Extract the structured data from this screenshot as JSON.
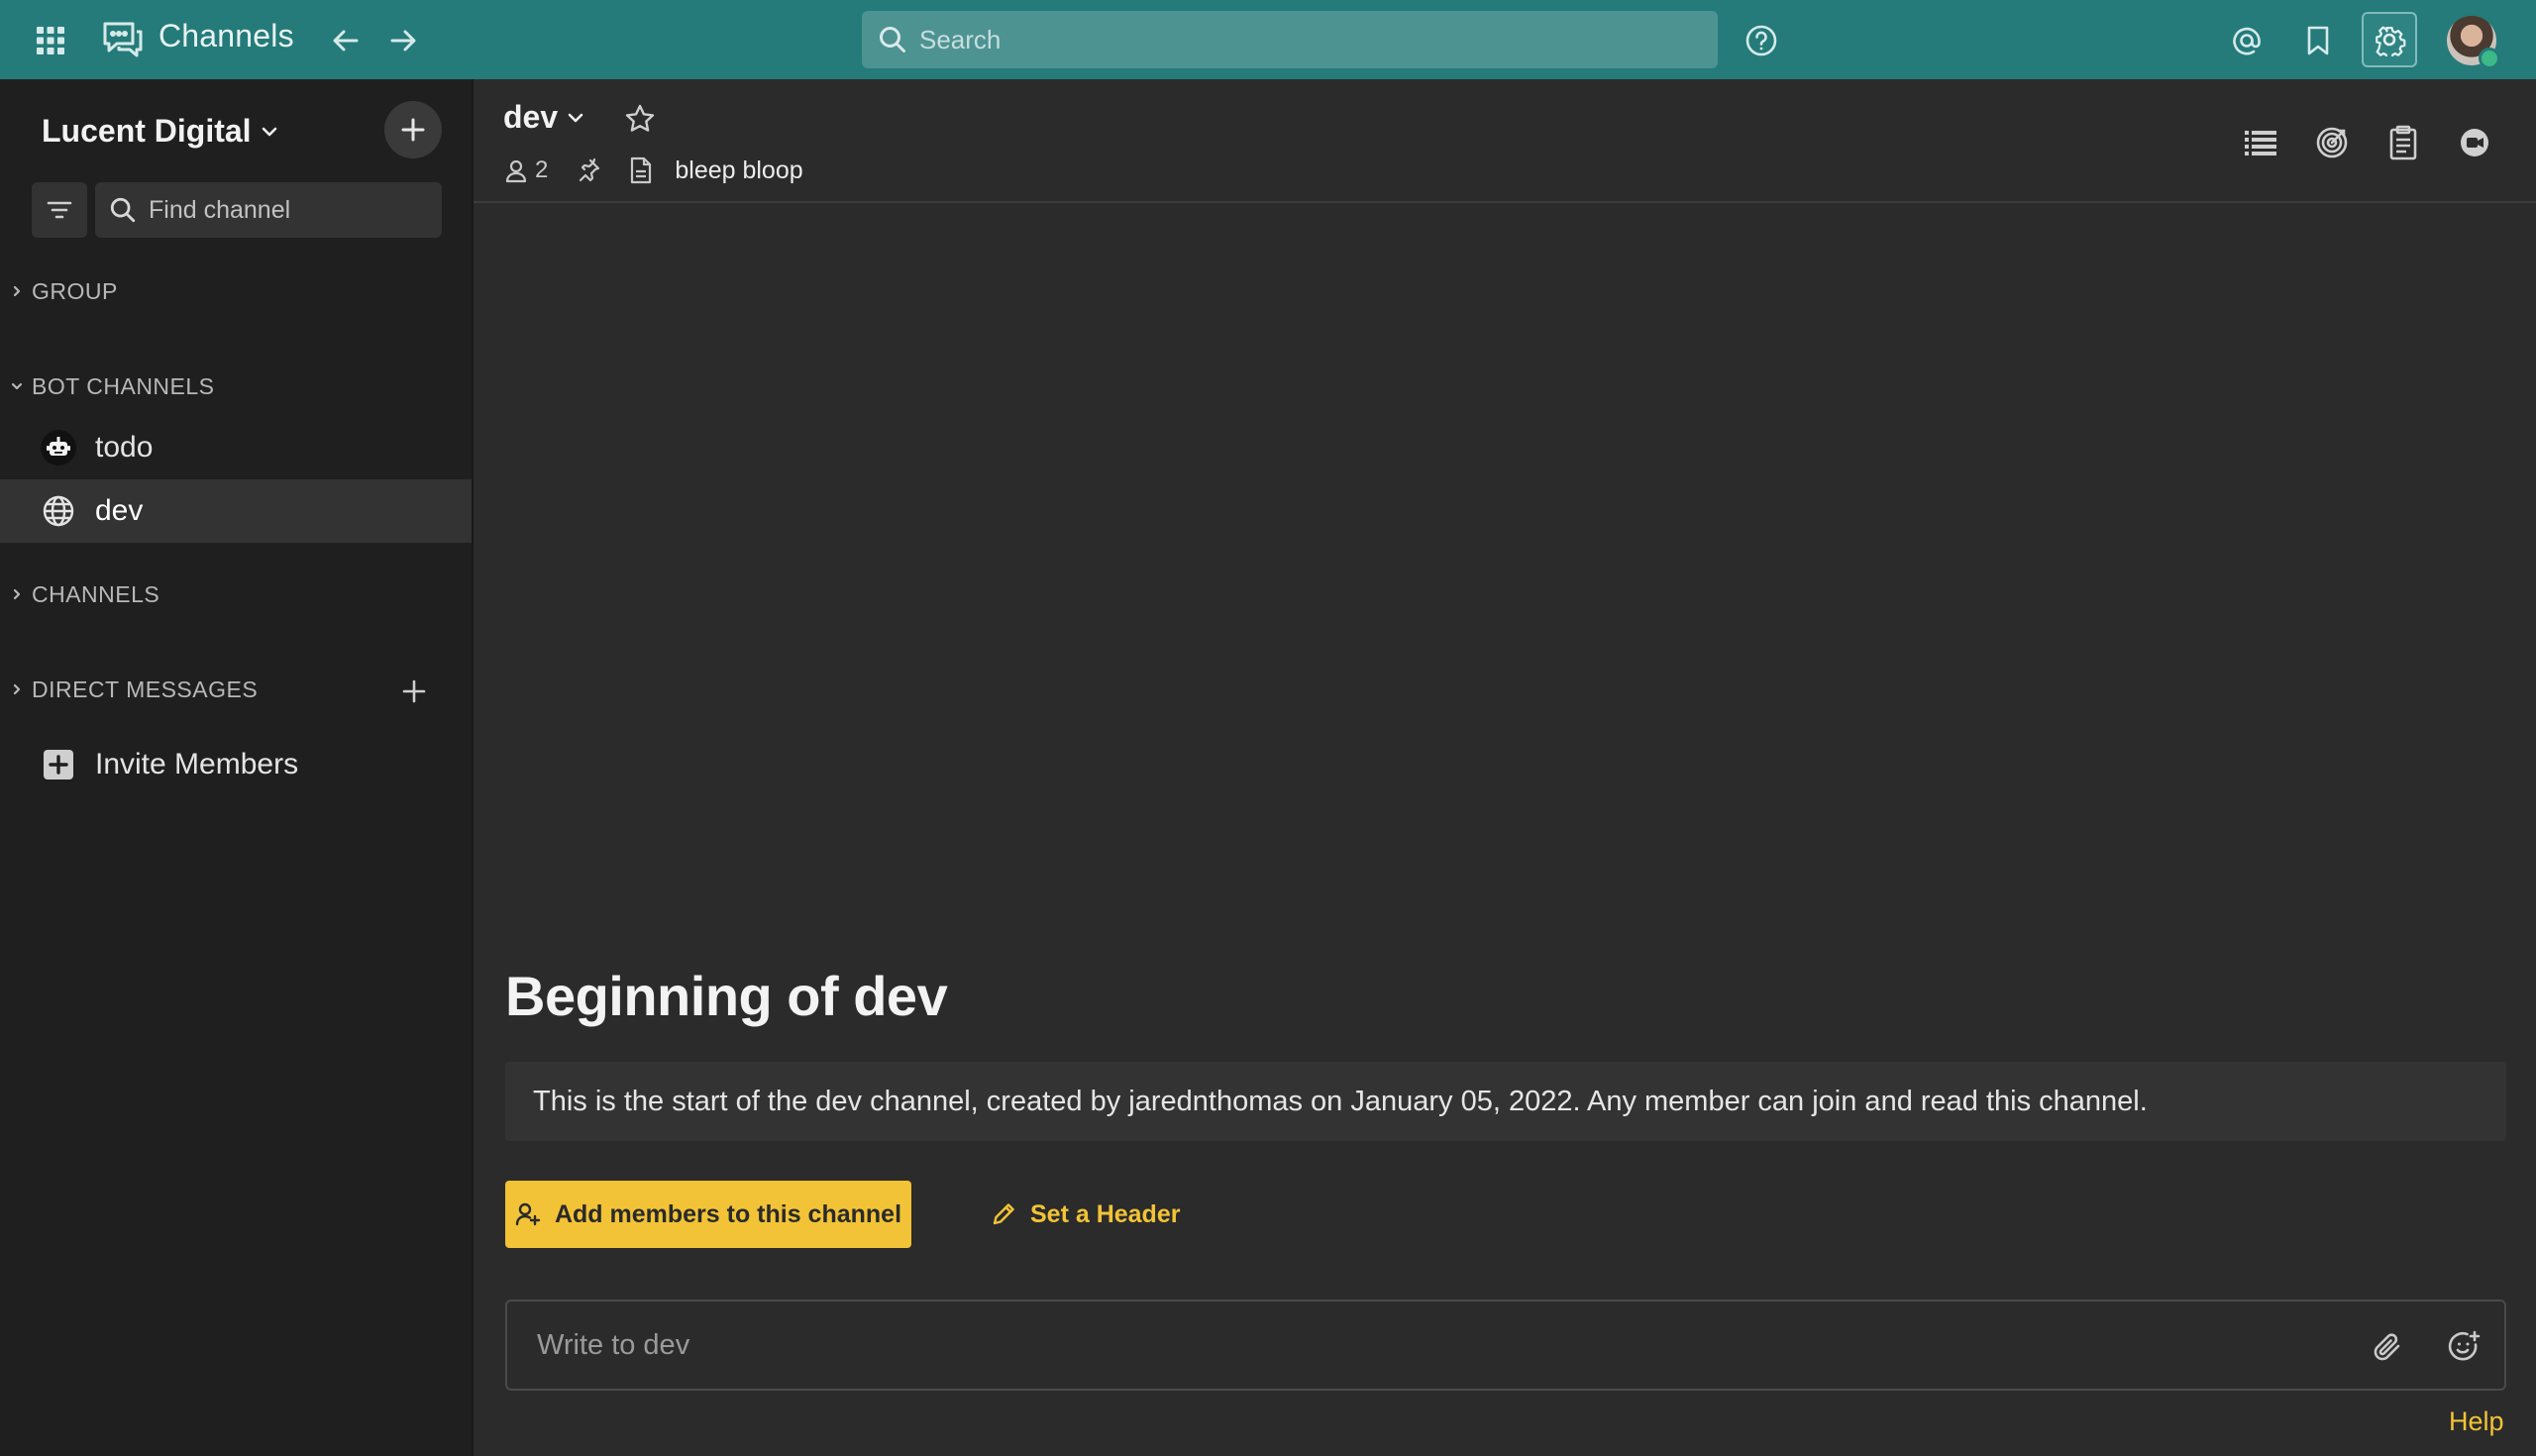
{
  "topbar": {
    "app_title": "Channels",
    "search_placeholder": "Search",
    "icons": {
      "apps": "grid-icon",
      "app": "chat-bubbles-icon",
      "back": "arrow-left-icon",
      "forward": "arrow-right-icon",
      "help": "question-circle-icon",
      "mentions": "at-icon",
      "saved": "bookmark-icon",
      "settings": "gear-icon"
    }
  },
  "sidebar": {
    "team_name": "Lucent Digital",
    "find_placeholder": "Find channel",
    "sections": {
      "group": "GROUP",
      "bot_channels": "BOT CHANNELS",
      "channels": "CHANNELS",
      "direct_messages": "DIRECT MESSAGES"
    },
    "items": [
      {
        "label": "todo",
        "icon": "bot-icon"
      },
      {
        "label": "dev",
        "icon": "globe-icon",
        "active": true
      }
    ],
    "invite_label": "Invite Members"
  },
  "channel": {
    "name": "dev",
    "member_count": "2",
    "topic": "bleep bloop"
  },
  "intro": {
    "title": "Beginning of dev",
    "description": "This is the start of the dev channel, created by jarednthomas on January 05, 2022. Any member can join and read this channel.",
    "add_members_label": "Add members to this channel",
    "set_header_label": "Set a Header"
  },
  "composer": {
    "placeholder": "Write to dev"
  },
  "footer": {
    "help_label": "Help"
  },
  "colors": {
    "topbar": "#247b7a",
    "sidebar": "#1f1f1f",
    "main": "#2b2b2b",
    "accent": "#f2c336"
  }
}
